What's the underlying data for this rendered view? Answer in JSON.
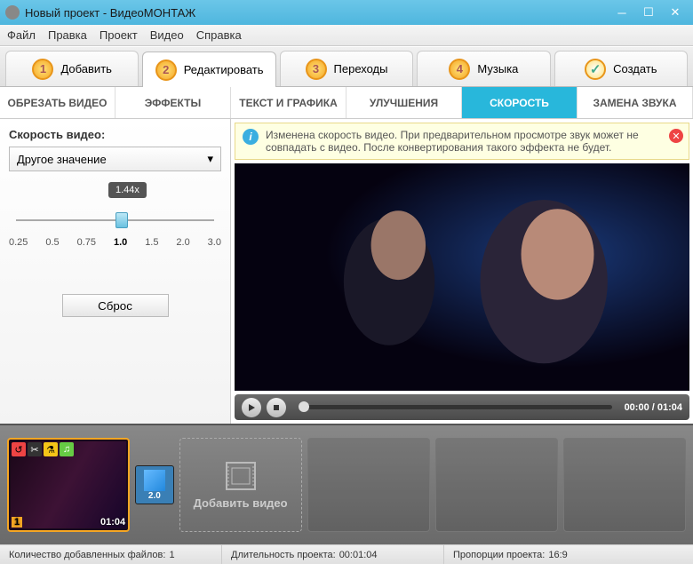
{
  "window": {
    "title": "Новый проект - ВидеоМОНТАЖ"
  },
  "menu": {
    "file": "Файл",
    "edit": "Правка",
    "project": "Проект",
    "video": "Видео",
    "help": "Справка"
  },
  "steps": {
    "add": "Добавить",
    "edit": "Редактировать",
    "transitions": "Переходы",
    "music": "Музыка",
    "create": "Создать",
    "n1": "1",
    "n2": "2",
    "n3": "3",
    "n4": "4",
    "check": "✓"
  },
  "subtabs": {
    "crop": "ОБРЕЗАТЬ ВИДЕО",
    "effects": "ЭФФЕКТЫ",
    "text": "ТЕКСТ И ГРАФИКА",
    "enhance": "УЛУЧШЕНИЯ",
    "speed": "СКОРОСТЬ",
    "audio": "ЗАМЕНА ЗВУКА"
  },
  "speed": {
    "label": "Скорость видео:",
    "select": "Другое значение",
    "tooltip": "1.44x",
    "ticks": [
      "0.25",
      "0.5",
      "0.75",
      "1.0",
      "1.5",
      "2.0",
      "3.0"
    ],
    "reset": "Сброс"
  },
  "notice": {
    "text": "Изменена скорость видео. При предварительном просмотре звук может не совпадать с видео. После конвертирования такого эффекта не будет."
  },
  "player": {
    "time": "00:00 / 01:04"
  },
  "timeline": {
    "clip": {
      "index": "1",
      "duration": "01:04"
    },
    "transition": "2.0",
    "add": "Добавить видео"
  },
  "status": {
    "files_label": "Количество добавленных файлов:",
    "files_val": "1",
    "dur_label": "Длительность проекта:",
    "dur_val": "00:01:04",
    "ratio_label": "Пропорции проекта:",
    "ratio_val": "16:9"
  }
}
